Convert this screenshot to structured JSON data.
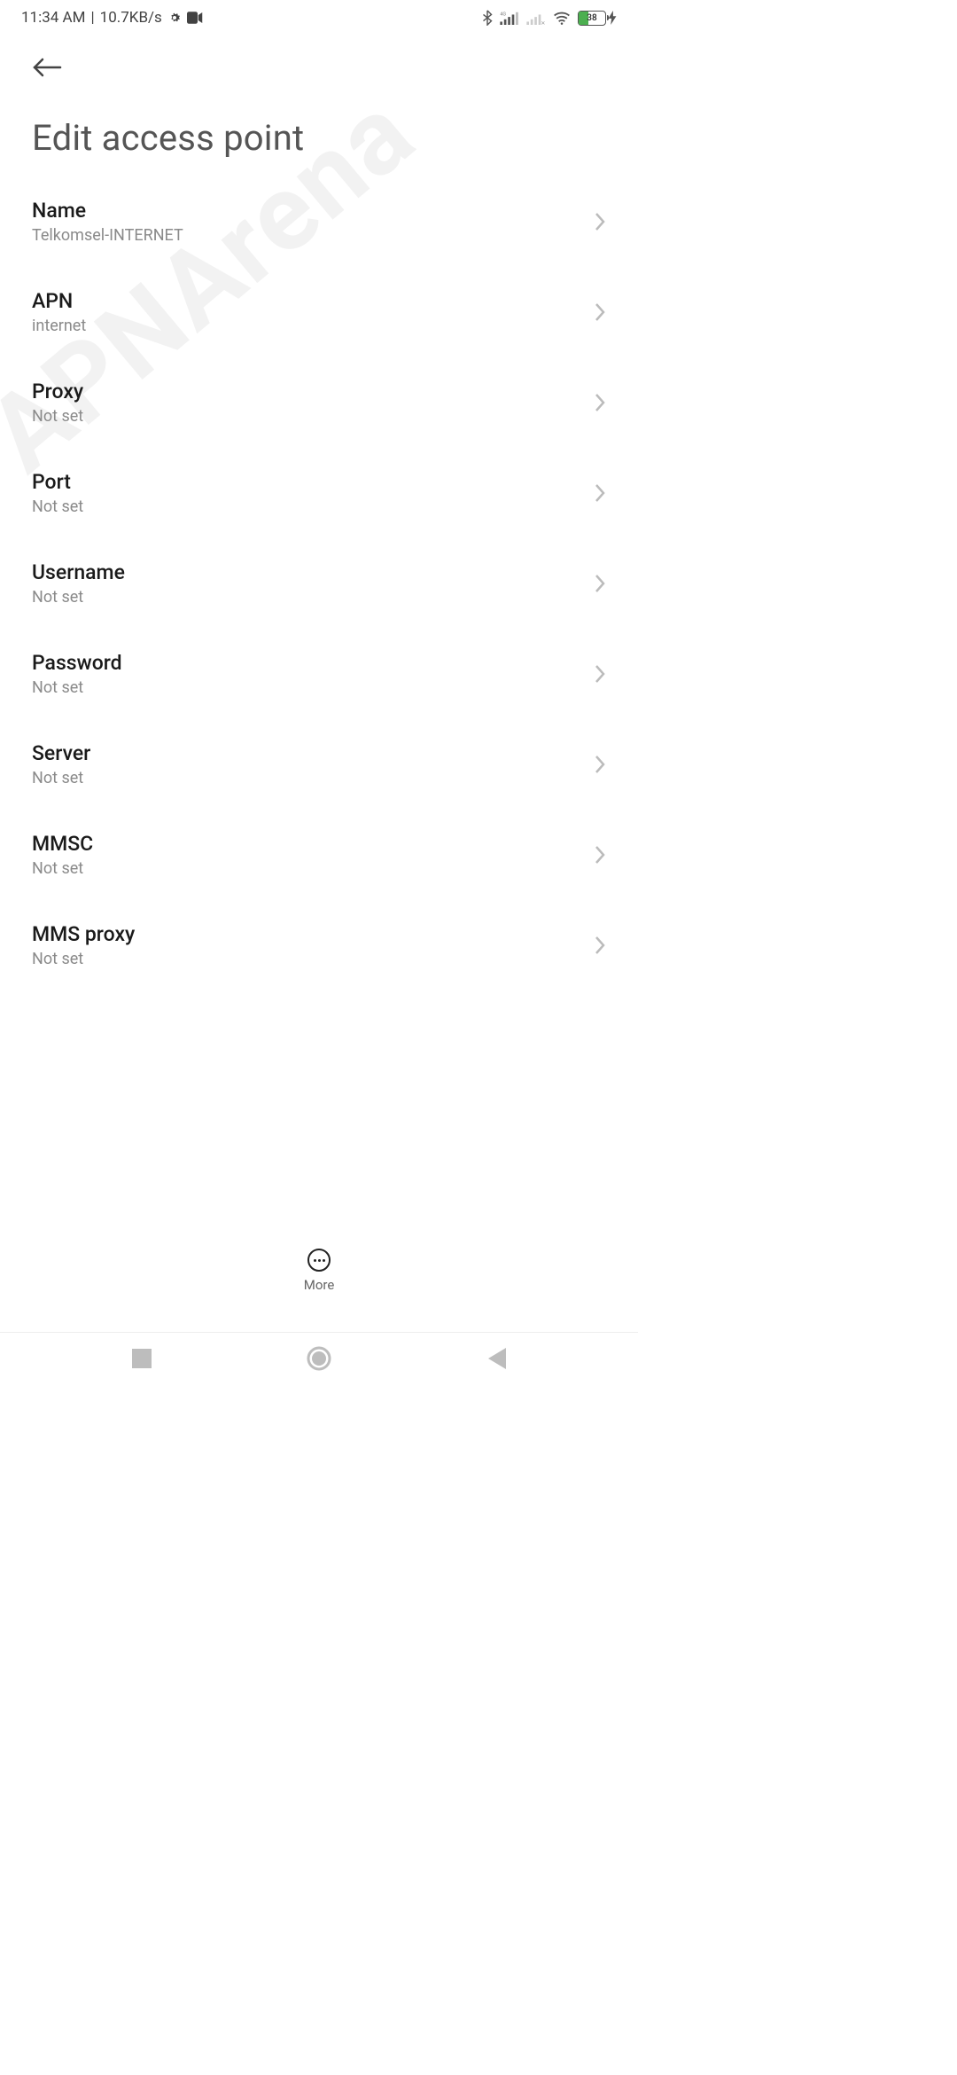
{
  "status": {
    "time": "11:34 AM",
    "speed": "10.7KB/s",
    "battery_pct": "38"
  },
  "header": {
    "title": "Edit access point"
  },
  "settings": [
    {
      "label": "Name",
      "value": "Telkomsel-INTERNET"
    },
    {
      "label": "APN",
      "value": "internet"
    },
    {
      "label": "Proxy",
      "value": "Not set"
    },
    {
      "label": "Port",
      "value": "Not set"
    },
    {
      "label": "Username",
      "value": "Not set"
    },
    {
      "label": "Password",
      "value": "Not set"
    },
    {
      "label": "Server",
      "value": "Not set"
    },
    {
      "label": "MMSC",
      "value": "Not set"
    },
    {
      "label": "MMS proxy",
      "value": "Not set"
    }
  ],
  "actions": {
    "more": "More"
  },
  "watermark": "APNArena"
}
